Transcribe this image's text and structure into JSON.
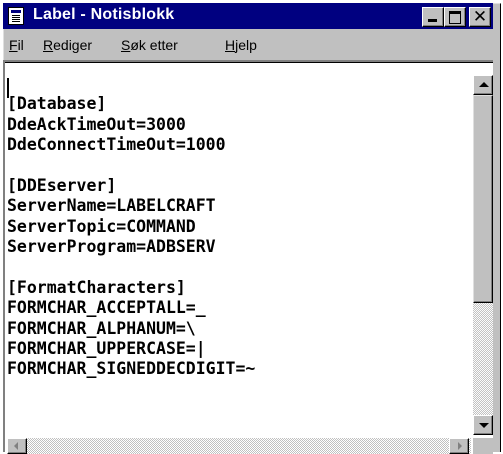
{
  "window": {
    "title": "Label - Notisblokk",
    "icon": "notepad-icon",
    "controls": [
      "minimize-icon",
      "maximize-icon",
      "close-icon"
    ],
    "close_glyph": "✕"
  },
  "menubar": {
    "items": [
      {
        "accel": "F",
        "rest": "il"
      },
      {
        "accel": "R",
        "rest": "ediger"
      },
      {
        "accel": "S",
        "rest": "øk etter"
      },
      {
        "accel": "H",
        "rest": "jelp"
      }
    ]
  },
  "editor": {
    "lines": [
      "",
      "[Database]",
      "DdeAckTimeOut=3000",
      "DdeConnectTimeOut=1000",
      "",
      "[DDEserver]",
      "ServerName=LABELCRAFT",
      "ServerTopic=COMMAND",
      "ServerProgram=ADBSERV",
      "",
      "[FormatCharacters]",
      "FORMCHAR_ACCEPTALL=_",
      "FORMCHAR_ALPHANUM=\\",
      "FORMCHAR_UPPERCASE=|",
      "FORMCHAR_SIGNEDDECDIGIT=~"
    ]
  },
  "colors": {
    "titlebar": "#000080",
    "face": "#c0c0c0",
    "text": "#000000"
  }
}
